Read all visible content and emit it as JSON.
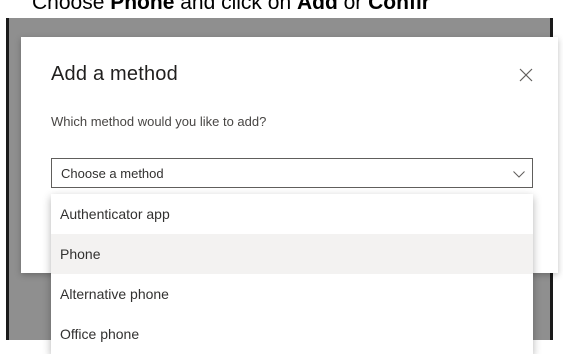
{
  "caption": {
    "part1": "Choose ",
    "bold1": "Phone",
    "part2": " and click on ",
    "bold2": "Add",
    "part3": " or ",
    "bold3": "Confir"
  },
  "dialog": {
    "title": "Add a method",
    "close_icon": "close-icon",
    "subtitle": "Which method would you like to add?",
    "select": {
      "placeholder": "Choose a method",
      "chevron_icon": "chevron-down-icon"
    },
    "options": [
      {
        "label": "Authenticator app"
      },
      {
        "label": "Phone"
      },
      {
        "label": "Alternative phone"
      },
      {
        "label": "Office phone"
      }
    ],
    "highlighted_option": "Phone"
  },
  "colors": {
    "overlay": "#8f8f8f",
    "dialog_bg": "#ffffff",
    "highlight": "#f3f2f1",
    "text": "#323130"
  }
}
